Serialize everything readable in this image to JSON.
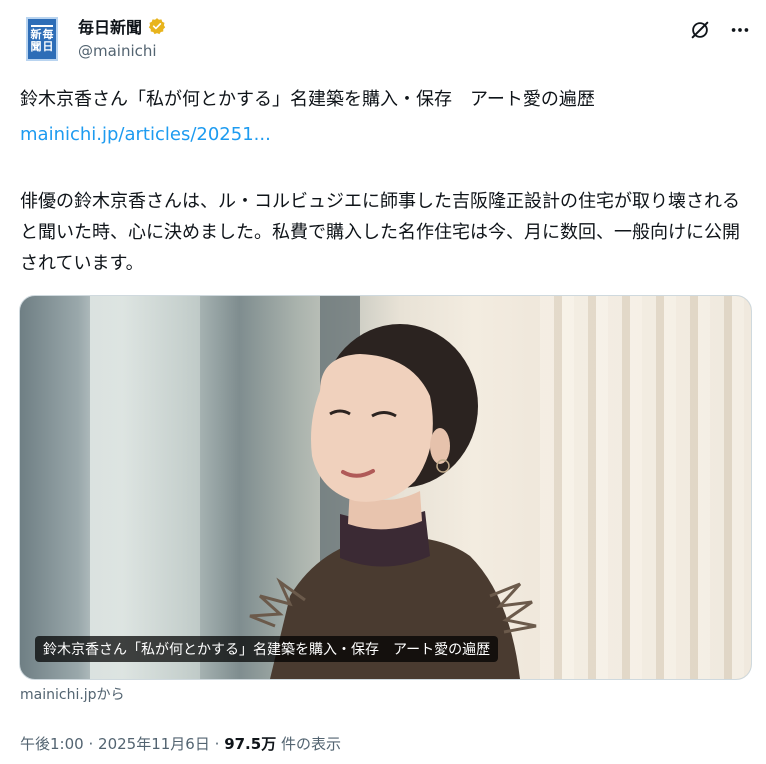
{
  "account": {
    "avatar_text": [
      "新",
      "毎",
      "聞",
      "日"
    ],
    "display_name": "毎日新聞",
    "handle": "@mainichi",
    "verified_color": "#e8b41c"
  },
  "actions": {
    "grok_icon": "grok-icon",
    "more_icon": "more-icon"
  },
  "post": {
    "title": "鈴木京香さん「私が何とかする」名建築を購入・保存　アート愛の遍歴",
    "link": "mainichi.jp/articles/20251...",
    "body": "俳優の鈴木京香さんは、ル・コルビュジエに師事した吉阪隆正設計の住宅が取り壊されると聞いた時、心に決めました。私費で購入した名作住宅は今、月に数回、一般向けに公開されています。"
  },
  "card": {
    "caption": "鈴木京香さん「私が何とかする」名建築を購入・保存　アート愛の遍歴",
    "source": "mainichi.jpから"
  },
  "meta": {
    "time": "午後1:00",
    "separator": "·",
    "date": "2025年11月6日",
    "views_count": "97.5万",
    "views_label": "件の表示"
  },
  "colors": {
    "link": "#1d9bf0",
    "muted": "#536471",
    "text": "#0f1419"
  }
}
